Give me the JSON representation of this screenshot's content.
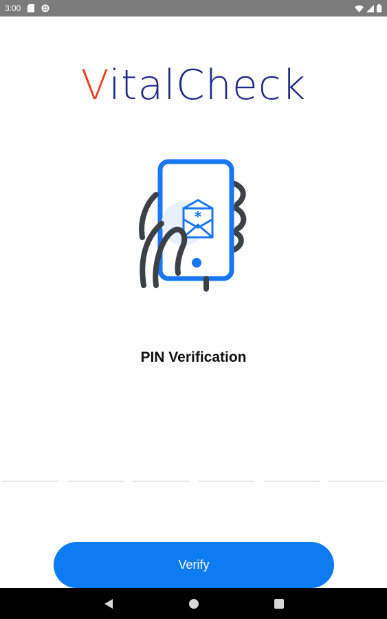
{
  "status_bar": {
    "time": "3:00",
    "icons": [
      "sd-card-icon",
      "data-saver-icon",
      "wifi-icon",
      "signal-icon",
      "battery-icon"
    ]
  },
  "app": {
    "logo_first": "V",
    "logo_rest": "italCheck",
    "brand_colors": {
      "accent": "#e8411d",
      "primary": "#1e2a8a",
      "illustration_blue": "#1877f2",
      "illustration_dark": "#3c4148"
    }
  },
  "main": {
    "illustration_icon": "phone-pin-envelope-icon",
    "title": "PIN Verification",
    "pin_digits": [
      "",
      "",
      "",
      "",
      "",
      ""
    ]
  },
  "actions": {
    "verify_label": "Verify",
    "verify_color": "#0d7bf2"
  },
  "nav": {
    "icons": [
      "back-icon",
      "home-icon",
      "recents-icon"
    ]
  }
}
